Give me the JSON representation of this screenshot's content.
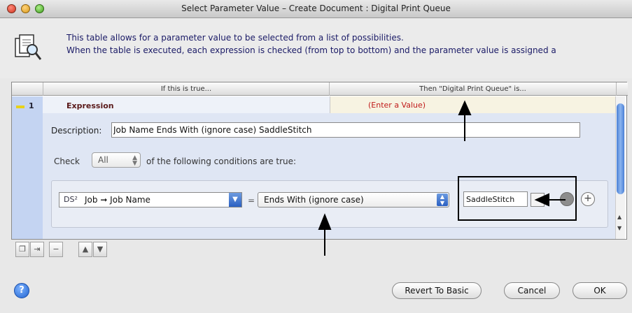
{
  "window": {
    "title": "Select Parameter Value – Create Document : Digital Print Queue"
  },
  "info": {
    "line1": "This table allows for a parameter value to be selected from a list of possibilities.",
    "line2": "When the table is executed, each expression is checked (from top to bottom) and the parameter value is assigned a"
  },
  "table": {
    "col_if": "If this is true...",
    "col_then": "Then \"Digital Print Queue\" is...",
    "row_number": "1",
    "expression_tab": "Expression",
    "value_tab": "(Enter a Value)",
    "description_label": "Description:",
    "description_value": "Job Name Ends With (ignore case) SaddleStitch",
    "check_label": "Check",
    "check_value": "All",
    "check_after": "of the following conditions are true:",
    "condition": {
      "field_icon": "DS²",
      "field_text": "Job ➞ Job Name",
      "separator": "=",
      "operator": "Ends With (ignore case)",
      "value": "SaddleStitch"
    }
  },
  "toolbar": {
    "icons": [
      "duplicate-icon",
      "indent-icon",
      "remove-icon",
      "move-up-icon",
      "move-down-icon"
    ]
  },
  "footer": {
    "help": "?",
    "revert": "Revert To Basic",
    "cancel": "Cancel",
    "ok": "OK"
  },
  "colors": {
    "accent_blue": "#2a5fc2",
    "row_gutter": "#c4d4f2",
    "value_tab_text": "#c01a1a"
  }
}
